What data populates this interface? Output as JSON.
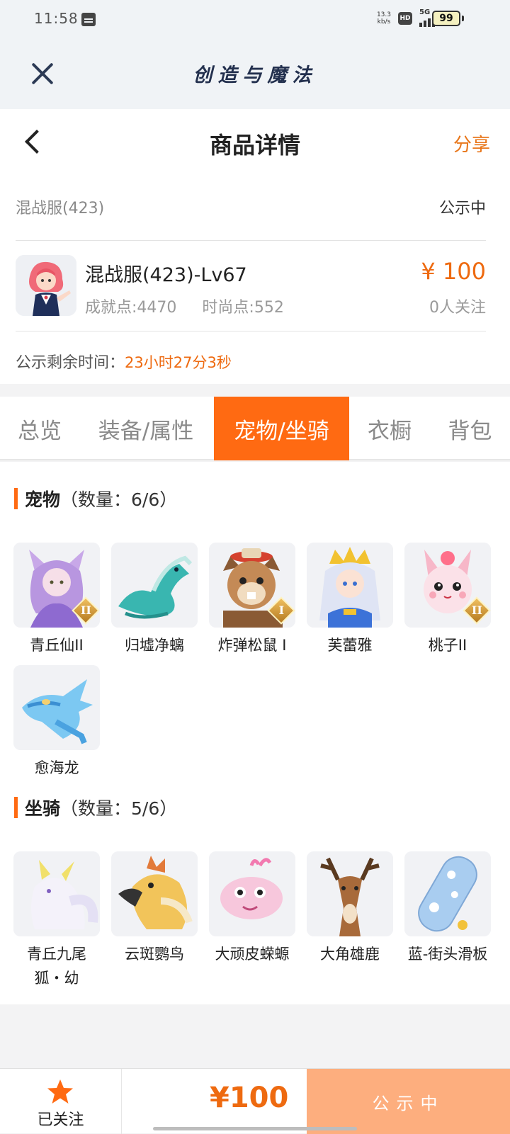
{
  "status_bar": {
    "time": "11:58",
    "net_speed_value": "13.3",
    "net_speed_unit": "kb/s",
    "hd_label": "HD",
    "signal_label": "5G",
    "battery": "99"
  },
  "app_bar": {
    "title": "创造与魔法"
  },
  "header": {
    "title": "商品详情",
    "share_label": "分享"
  },
  "listing": {
    "server": "混战服(423)",
    "status": "公示中",
    "character_name": "混战服(423)-Lv67",
    "achievement": "成就点:4470",
    "fashion": "时尚点:552",
    "price": "¥ 100",
    "watchers": "0人关注",
    "timer_label": "公示剩余时间：",
    "timer_value": "23小时27分3秒"
  },
  "tabs": [
    {
      "label": "总览",
      "active": false
    },
    {
      "label": "装备/属性",
      "active": false
    },
    {
      "label": "宠物/坐骑",
      "active": true
    },
    {
      "label": "衣橱",
      "active": false
    },
    {
      "label": "背包",
      "active": false
    }
  ],
  "pets": {
    "title": "宠物",
    "count": "（数量：6/6）",
    "items": [
      {
        "name": "青丘仙II",
        "icon": "fox-fairy-icon",
        "tier": "II"
      },
      {
        "name": "归墟净螭",
        "icon": "sea-dragon-icon",
        "tier": ""
      },
      {
        "name": "炸弹松鼠 I",
        "icon": "bomb-squirrel-icon",
        "tier": "I"
      },
      {
        "name": "芙蕾雅",
        "icon": "freya-icon",
        "tier": ""
      },
      {
        "name": "桃子II",
        "icon": "peach-bunny-icon",
        "tier": "II"
      },
      {
        "name": "愈海龙",
        "icon": "healing-sea-dragon-icon",
        "tier": ""
      }
    ]
  },
  "mounts": {
    "title": "坐骑",
    "count": "（数量：5/6）",
    "items": [
      {
        "name": "青丘九尾狐・幼",
        "icon": "nine-tail-fox-icon"
      },
      {
        "name": "云斑鹦鸟",
        "icon": "cloud-parrot-icon"
      },
      {
        "name": "大顽皮蝾螈",
        "icon": "axolotl-icon"
      },
      {
        "name": "大角雄鹿",
        "icon": "stag-icon"
      },
      {
        "name": "蓝-街头滑板",
        "icon": "skateboard-icon"
      }
    ]
  },
  "footer": {
    "follow_label": "已关注",
    "price": "¥100",
    "status_button": "公示中"
  },
  "colors": {
    "accent": "#ff6a12",
    "price": "#ee6a10",
    "button_disabled": "#fdae7e"
  }
}
